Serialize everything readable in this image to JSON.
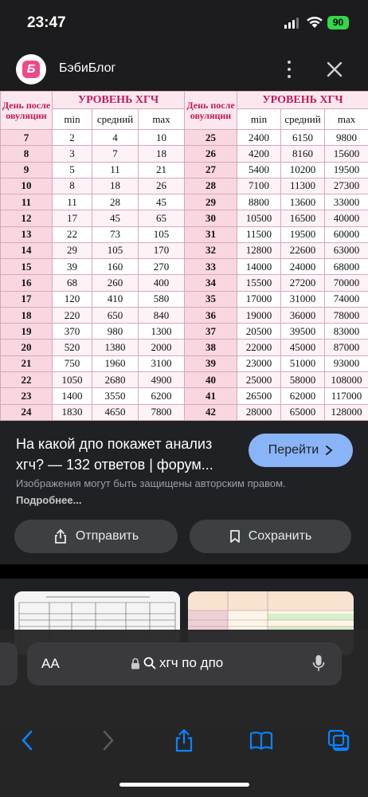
{
  "status": {
    "time": "23:47",
    "battery": "90"
  },
  "header": {
    "site_name": "БэбиБлог",
    "logo_letter": "Б"
  },
  "hcg_table": {
    "day_header": "День после овуляции",
    "level_header": "УРОВЕНЬ ХГЧ",
    "sub_headers": [
      "min",
      "средний",
      "max"
    ],
    "rows": [
      {
        "left": [
          "7",
          "2",
          "4",
          "10"
        ],
        "right": [
          "25",
          "2400",
          "6150",
          "9800"
        ]
      },
      {
        "left": [
          "8",
          "3",
          "7",
          "18"
        ],
        "right": [
          "26",
          "4200",
          "8160",
          "15600"
        ]
      },
      {
        "left": [
          "9",
          "5",
          "11",
          "21"
        ],
        "right": [
          "27",
          "5400",
          "10200",
          "19500"
        ]
      },
      {
        "left": [
          "10",
          "8",
          "18",
          "26"
        ],
        "right": [
          "28",
          "7100",
          "11300",
          "27300"
        ]
      },
      {
        "left": [
          "11",
          "11",
          "28",
          "45"
        ],
        "right": [
          "29",
          "8800",
          "13600",
          "33000"
        ]
      },
      {
        "left": [
          "12",
          "17",
          "45",
          "65"
        ],
        "right": [
          "30",
          "10500",
          "16500",
          "40000"
        ]
      },
      {
        "left": [
          "13",
          "22",
          "73",
          "105"
        ],
        "right": [
          "31",
          "11500",
          "19500",
          "60000"
        ]
      },
      {
        "left": [
          "14",
          "29",
          "105",
          "170"
        ],
        "right": [
          "32",
          "12800",
          "22600",
          "63000"
        ]
      },
      {
        "left": [
          "15",
          "39",
          "160",
          "270"
        ],
        "right": [
          "33",
          "14000",
          "24000",
          "68000"
        ]
      },
      {
        "left": [
          "16",
          "68",
          "260",
          "400"
        ],
        "right": [
          "34",
          "15500",
          "27200",
          "70000"
        ]
      },
      {
        "left": [
          "17",
          "120",
          "410",
          "580"
        ],
        "right": [
          "35",
          "17000",
          "31000",
          "74000"
        ]
      },
      {
        "left": [
          "18",
          "220",
          "650",
          "840"
        ],
        "right": [
          "36",
          "19000",
          "36000",
          "78000"
        ]
      },
      {
        "left": [
          "19",
          "370",
          "980",
          "1300"
        ],
        "right": [
          "37",
          "20500",
          "39500",
          "83000"
        ]
      },
      {
        "left": [
          "20",
          "520",
          "1380",
          "2000"
        ],
        "right": [
          "38",
          "22000",
          "45000",
          "87000"
        ]
      },
      {
        "left": [
          "21",
          "750",
          "1960",
          "3100"
        ],
        "right": [
          "39",
          "23000",
          "51000",
          "93000"
        ]
      },
      {
        "left": [
          "22",
          "1050",
          "2680",
          "4900"
        ],
        "right": [
          "40",
          "25000",
          "58000",
          "108000"
        ]
      },
      {
        "left": [
          "23",
          "1400",
          "3550",
          "6200"
        ],
        "right": [
          "41",
          "26500",
          "62000",
          "117000"
        ]
      },
      {
        "left": [
          "24",
          "1830",
          "4650",
          "7800"
        ],
        "right": [
          "42",
          "28000",
          "65000",
          "128000"
        ]
      }
    ]
  },
  "info": {
    "title": "На какой дпо покажет анализ хгч? — 132 ответов | форум...",
    "goto_label": "Перейти",
    "copyright_note": "Изображения могут быть защищены авторским правом.",
    "more_link": "Подробнее...",
    "share_label": "Отправить",
    "save_label": "Сохранить"
  },
  "safari": {
    "aa_label": "AA",
    "url_text": "хгч по дпо"
  },
  "colors": {
    "accent_blue": "#8ab4f8",
    "table_header_pink": "#c2185b",
    "logo_pink": "#ec4a8b",
    "battery_green": "#32d74b"
  }
}
